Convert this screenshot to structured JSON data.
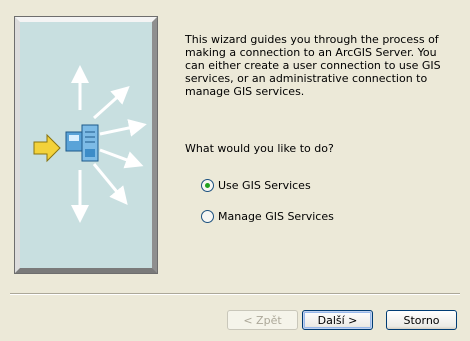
{
  "wizard": {
    "intro_text": "This wizard guides you through the process of making a connection to an ArcGIS Server.  You can either create a user connection to use GIS services, or an administrative connection to manage GIS services.",
    "question": "What would you like to do?",
    "options": [
      {
        "label": "Use GIS Services",
        "selected": true
      },
      {
        "label": "Manage GIS Services",
        "selected": false
      }
    ]
  },
  "buttons": {
    "back_label": "< Zpět",
    "back_enabled": false,
    "next_label": "Další >",
    "cancel_label": "Storno"
  },
  "illustration": {
    "icons": [
      "yellow-arrow-icon",
      "server-icon",
      "radiating-arrows-icon"
    ]
  },
  "colors": {
    "dialog_background": "#ece9d8",
    "panel_background": "#c8dfe0",
    "radio_selected": "#21a121",
    "button_border": "#003c74"
  }
}
